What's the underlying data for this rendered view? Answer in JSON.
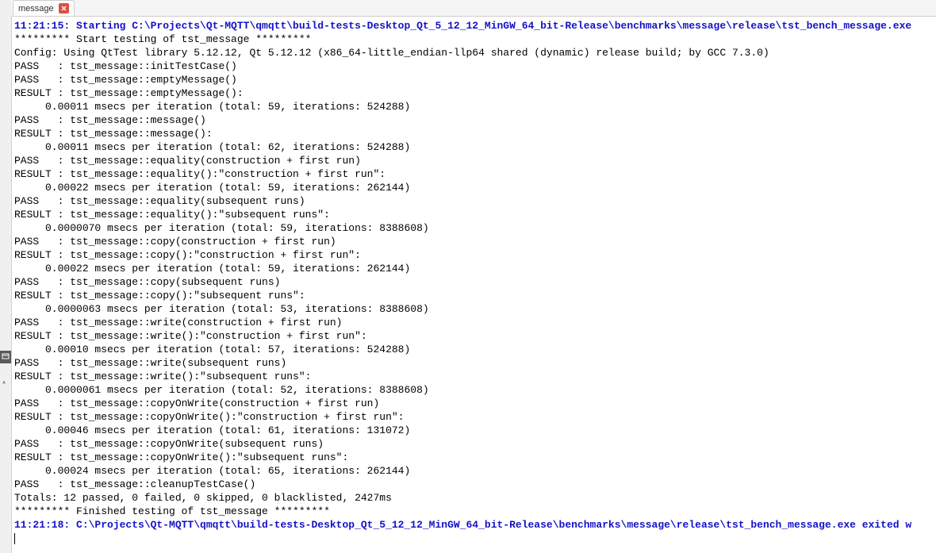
{
  "tab": {
    "label": "message"
  },
  "start_line": "11:21:15: Starting C:\\Projects\\Qt-MQTT\\qmqtt\\build-tests-Desktop_Qt_5_12_12_MinGW_64_bit-Release\\benchmarks\\message\\release\\tst_bench_message.exe",
  "lines": [
    "********* Start testing of tst_message *********",
    "Config: Using QtTest library 5.12.12, Qt 5.12.12 (x86_64-little_endian-llp64 shared (dynamic) release build; by GCC 7.3.0)",
    "PASS   : tst_message::initTestCase()",
    "PASS   : tst_message::emptyMessage()",
    "RESULT : tst_message::emptyMessage():",
    "     0.00011 msecs per iteration (total: 59, iterations: 524288)",
    "PASS   : tst_message::message()",
    "RESULT : tst_message::message():",
    "     0.00011 msecs per iteration (total: 62, iterations: 524288)",
    "PASS   : tst_message::equality(construction + first run)",
    "RESULT : tst_message::equality():\"construction + first run\":",
    "     0.00022 msecs per iteration (total: 59, iterations: 262144)",
    "PASS   : tst_message::equality(subsequent runs)",
    "RESULT : tst_message::equality():\"subsequent runs\":",
    "     0.0000070 msecs per iteration (total: 59, iterations: 8388608)",
    "PASS   : tst_message::copy(construction + first run)",
    "RESULT : tst_message::copy():\"construction + first run\":",
    "     0.00022 msecs per iteration (total: 59, iterations: 262144)",
    "PASS   : tst_message::copy(subsequent runs)",
    "RESULT : tst_message::copy():\"subsequent runs\":",
    "     0.0000063 msecs per iteration (total: 53, iterations: 8388608)",
    "PASS   : tst_message::write(construction + first run)",
    "RESULT : tst_message::write():\"construction + first run\":",
    "     0.00010 msecs per iteration (total: 57, iterations: 524288)",
    "PASS   : tst_message::write(subsequent runs)",
    "RESULT : tst_message::write():\"subsequent runs\":",
    "     0.0000061 msecs per iteration (total: 52, iterations: 8388608)",
    "PASS   : tst_message::copyOnWrite(construction + first run)",
    "RESULT : tst_message::copyOnWrite():\"construction + first run\":",
    "     0.00046 msecs per iteration (total: 61, iterations: 131072)",
    "PASS   : tst_message::copyOnWrite(subsequent runs)",
    "RESULT : tst_message::copyOnWrite():\"subsequent runs\":",
    "     0.00024 msecs per iteration (total: 65, iterations: 262144)",
    "PASS   : tst_message::cleanupTestCase()",
    "Totals: 12 passed, 0 failed, 0 skipped, 0 blacklisted, 2427ms",
    "********* Finished testing of tst_message *********"
  ],
  "end_line": "11:21:18: C:\\Projects\\Qt-MQTT\\qmqtt\\build-tests-Desktop_Qt_5_12_12_MinGW_64_bit-Release\\benchmarks\\message\\release\\tst_bench_message.exe exited w"
}
